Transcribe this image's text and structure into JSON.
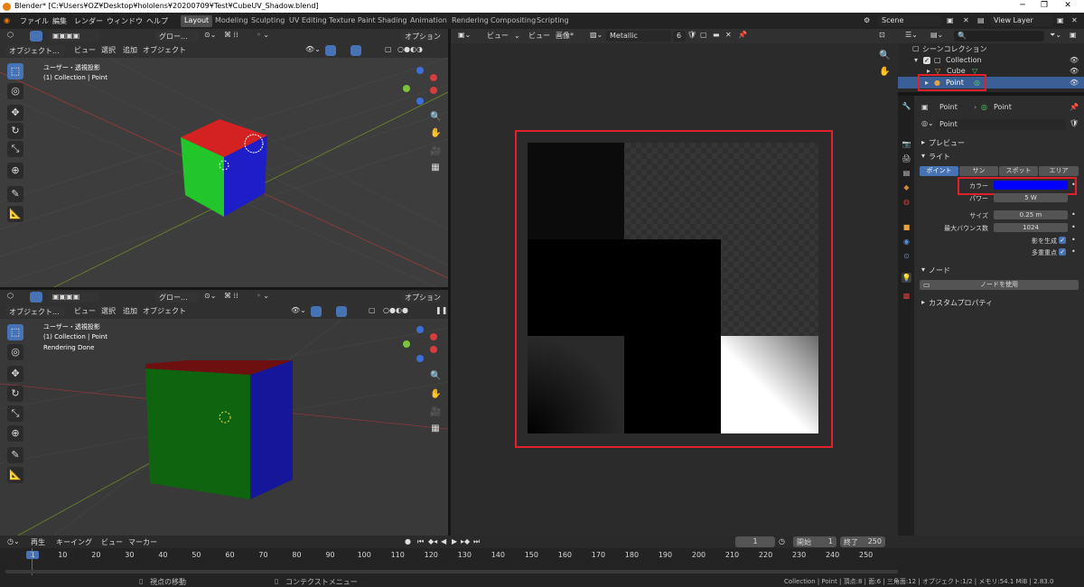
{
  "titlebar": {
    "title": "Blender* [C:¥Users¥OZ¥Desktop¥hololens¥20200709¥Test¥CubeUV_Shadow.blend]"
  },
  "menu": {
    "items": [
      "ファイル",
      "編集",
      "レンダー",
      "ウィンドウ",
      "ヘルプ"
    ]
  },
  "workspaces": [
    "Layout",
    "Modeling",
    "Sculpting",
    "UV Editing",
    "Texture Paint",
    "Shading",
    "Animation",
    "Rendering",
    "Compositing",
    "Scripting"
  ],
  "topbar": {
    "scene": "Scene",
    "view_layer": "View Layer"
  },
  "viewport_top": {
    "mode": "オブジェクト...",
    "view": "ビュー",
    "select": "選択",
    "add": "追加",
    "object": "オブジェクト",
    "orient": "グロー...",
    "options": "オプション",
    "overlay_line1": "ユーザー・透視投影",
    "overlay_line2": "(1) Collection | Point"
  },
  "viewport_bottom": {
    "mode": "オブジェクト...",
    "view": "ビュー",
    "select": "選択",
    "add": "追加",
    "object": "オブジェクト",
    "orient": "グロー...",
    "options": "オプション",
    "overlay_line1": "ユーザー・透視投影",
    "overlay_line2": "(1) Collection | Point",
    "overlay_line3": "Rendering Done"
  },
  "image_editor": {
    "view": "ビュー",
    "view2": "ビュー",
    "image": "画像*",
    "image_name": "Metallic",
    "slot": "6"
  },
  "outliner": {
    "root": "シーンコレクション",
    "collection": "Collection",
    "cube": "Cube",
    "point": "Point"
  },
  "properties": {
    "breadcrumb_a": "Point",
    "breadcrumb_b": "Point",
    "data_name": "Point",
    "preview": "プレビュー",
    "light": "ライト",
    "light_types": [
      "ポイント",
      "サン",
      "スポット",
      "エリア"
    ],
    "color_label": "カラー",
    "color_value": "#0000ff",
    "power_label": "パワー",
    "power_value": "5 W",
    "size_label": "サイズ",
    "size_value": "0.25 m",
    "bounce_label": "最大バウンス数",
    "bounce_value": "1024",
    "cast_shadow_label": "影を生成",
    "mis_label": "多重重点",
    "nodes": "ノード",
    "use_nodes": "ノードを使用",
    "custom_props": "カスタムプロパティ"
  },
  "timeline": {
    "playback": "再生",
    "keying": "キーイング",
    "view": "ビュー",
    "marker": "マーカー",
    "current_frame": "1",
    "start_label": "開始",
    "start_value": "1",
    "end_label": "終了",
    "end_value": "250",
    "ticks": [
      "1",
      "10",
      "20",
      "30",
      "40",
      "50",
      "60",
      "70",
      "80",
      "90",
      "100",
      "110",
      "120",
      "130",
      "140",
      "150",
      "160",
      "170",
      "180",
      "190",
      "200",
      "210",
      "220",
      "230",
      "240",
      "250"
    ]
  },
  "statusbar": {
    "hint1": "視点の移動",
    "hint2": "コンテクストメニュー",
    "stats": "Collection | Point | 頂点:8 | 面:6 | 三角面:12 | オブジェクト:1/2 | メモリ:54.1 MiB | 2.83.0"
  },
  "colors": {
    "accent": "#4772b3",
    "highlight": "#e0202a",
    "light_color": "#0000ff"
  }
}
